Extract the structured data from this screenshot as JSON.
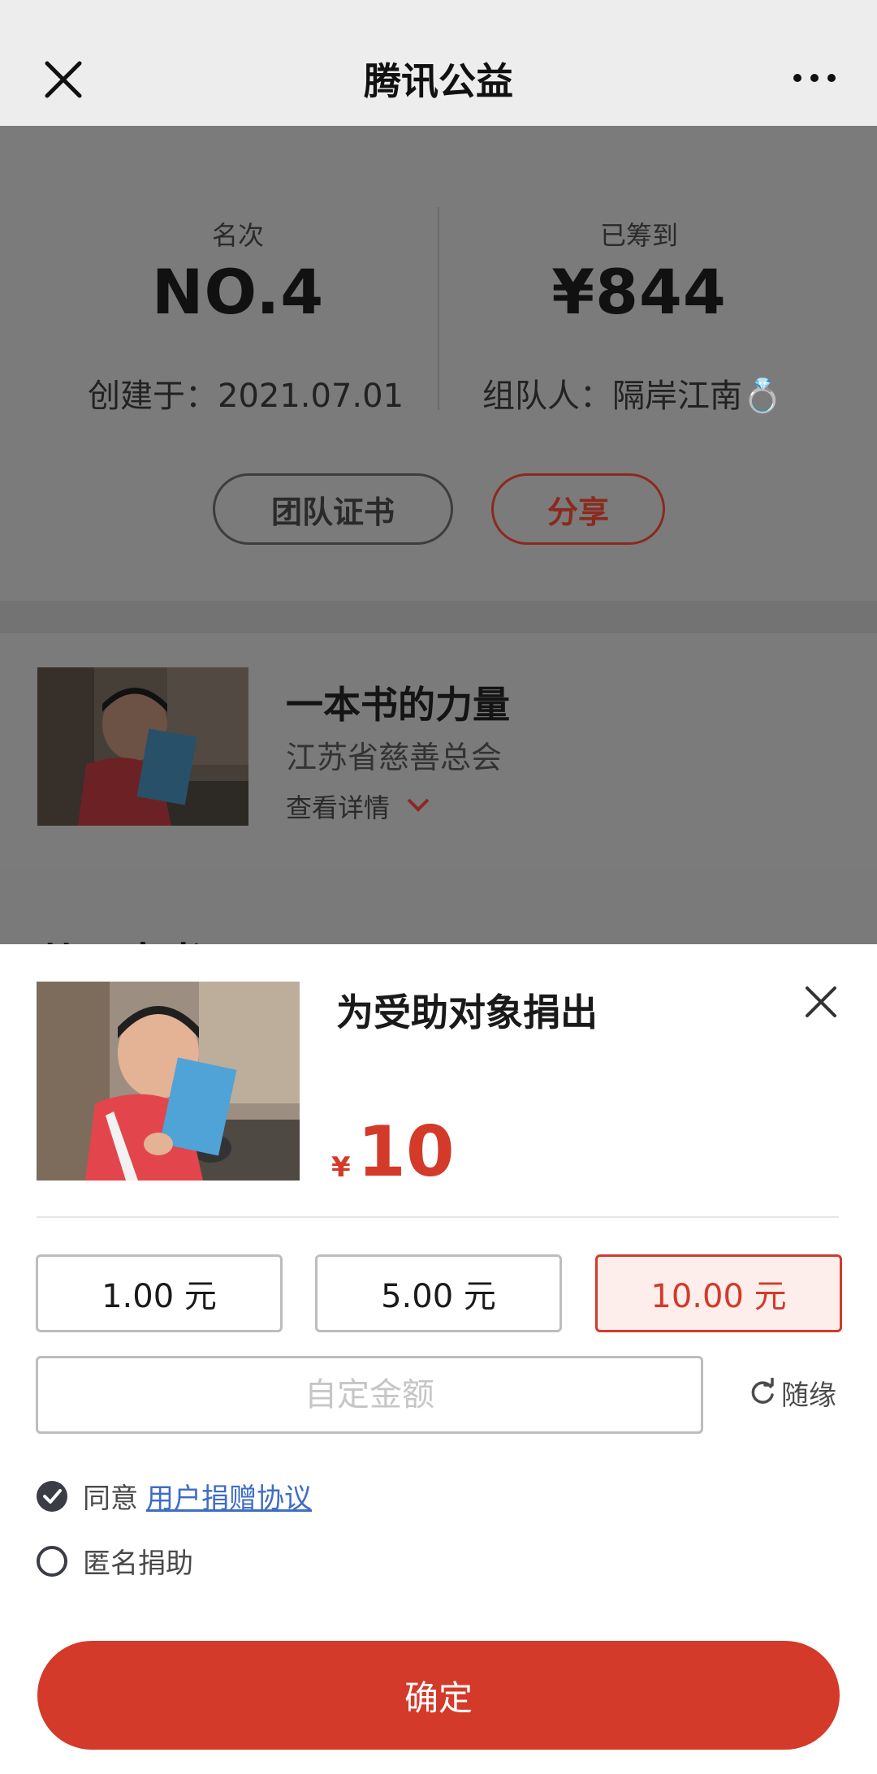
{
  "header": {
    "title": "腾讯公益"
  },
  "stats": {
    "rank_label": "名次",
    "rank_value": "NO.4",
    "raised_label": "已筹到",
    "raised_value": "¥844",
    "created": "创建于：2021.07.01",
    "leader": "组队人：隔岸江南💍",
    "cert_button": "团队证书",
    "share_button": "分享"
  },
  "project": {
    "name": "一本书的力量",
    "org": "江苏省慈善总会",
    "detail_link": "查看详情",
    "partial_heading": "从一本书开"
  },
  "donation": {
    "title": "为受助对象捐出",
    "currency": "¥",
    "amount": "10",
    "options": [
      "1.00 元",
      "5.00 元",
      "10.00 元"
    ],
    "selected_option": "10.00 元",
    "custom_placeholder": "自定金额",
    "random_label": "随缘",
    "agree_prefix": "同意",
    "agreement_link": "用户捐赠协议",
    "anonymous_label": "匿名捐助",
    "confirm_label": "确定"
  },
  "colors": {
    "accent": "#d33a29",
    "link": "#3f6cc4"
  }
}
